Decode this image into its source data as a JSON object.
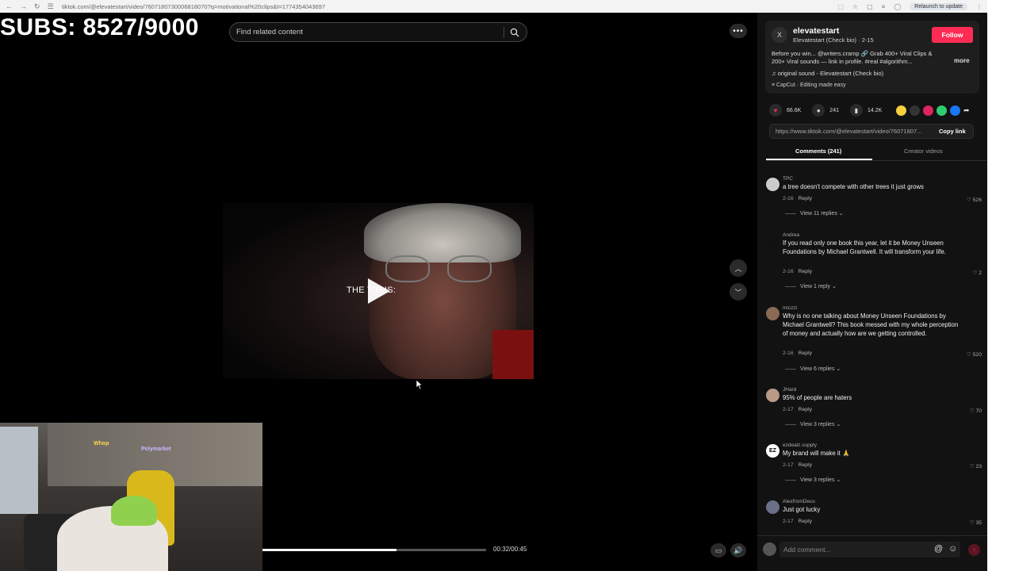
{
  "browser": {
    "url": "tiktok.com/@elevatestart/video/7607180730006818070?q=motivational%20clips&t=1774354043697",
    "relaunch_label": "Relaunch to update"
  },
  "overlay": {
    "subs_counter": "SUBS: 8527/9000"
  },
  "search": {
    "placeholder": "Find related content"
  },
  "video": {
    "caption": "THE T  H IS:",
    "progress": 0.6,
    "time": "00:32/00:45"
  },
  "webcam": {
    "neon_1": "Whop",
    "neon_2": "Polymarket"
  },
  "author": {
    "avatar_letter": "X",
    "name": "elevatestart",
    "subtitle": "Elevatestart (Check bio) · 2-15",
    "follow_label": "Follow",
    "description": "Before you win... @writers.cramp 🔗 Grab 400+ Viral Clips & 200+ Viral sounds — link in profile. #real #algorithm...",
    "more_label": "more",
    "music": "original sound - Elevatestart (Check bio)",
    "capcut": "CapCut · Editing made easy"
  },
  "stats": {
    "likes": "66.6K",
    "comments": "241",
    "saves": "14.2K"
  },
  "share": {
    "url": "https://www.tiktok.com/@elevatestart/video/76071807...",
    "copy_label": "Copy link"
  },
  "tabs": {
    "comments": "Comments (241)",
    "creator_videos": "Creator videos"
  },
  "comments": [
    {
      "user": "TPC",
      "text": "a tree doesn't compete with other trees it just grows",
      "date": "2-16",
      "reply": "Reply",
      "likes": "526",
      "replies": "View 11 replies"
    },
    {
      "user": "Andrea",
      "text": "If you read only one book this year, let it be Money Unseen Foundations by Michael Grantwell. It will transform your life.",
      "date": "2-16",
      "reply": "Reply",
      "likes": "2",
      "replies": "View 1 reply"
    },
    {
      "user": "miczzi",
      "text": "Why is no one talking about Money Unseen Foundations by Michael Grantwell? This book messed with my whole perception of money and actually how are we getting controlled.",
      "date": "2-16",
      "reply": "Reply",
      "likes": "520",
      "replies": "View 6 replies"
    },
    {
      "user": "JHard",
      "text": "95% of people are haters",
      "date": "2-17",
      "reply": "Reply",
      "likes": "70",
      "replies": "View 3 replies"
    },
    {
      "user": "ezdealz.supply",
      "text": "My brand will make it 🙏",
      "date": "2-17",
      "reply": "Reply",
      "likes": "23",
      "replies": "View 3 replies"
    },
    {
      "user": "AlexfromDeus",
      "text": "Just got lucky",
      "date": "2-17",
      "reply": "Reply",
      "likes": "35",
      "replies": ""
    }
  ],
  "add_comment": {
    "placeholder": "Add comment..."
  },
  "colors": {
    "accent": "#fe2c55",
    "panel_bg": "#121212"
  }
}
